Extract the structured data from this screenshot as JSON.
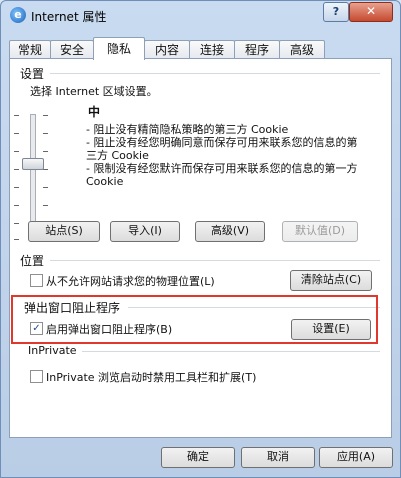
{
  "window": {
    "title": "Internet 属性",
    "help_label": "?",
    "close_label": "✕"
  },
  "tabs": [
    {
      "label": "常规"
    },
    {
      "label": "安全"
    },
    {
      "label": "隐私",
      "active": true
    },
    {
      "label": "内容"
    },
    {
      "label": "连接"
    },
    {
      "label": "程序"
    },
    {
      "label": "高级"
    }
  ],
  "settings": {
    "heading": "设置",
    "instruction": "选择 Internet 区域设置。",
    "level": "中",
    "descriptions": [
      "- 阻止没有精简隐私策略的第三方 Cookie",
      "- 阻止没有经您明确同意而保存可用来联系您的信息的第三方 Cookie",
      "- 限制没有经您默许而保存可用来联系您的信息的第一方 Cookie"
    ],
    "buttons": {
      "sites": "站点(S)",
      "import": "导入(I)",
      "advanced": "高级(V)",
      "default": "默认值(D)"
    }
  },
  "location": {
    "heading": "位置",
    "checkbox_label": "从不允许网站请求您的物理位置(L)",
    "checked": false,
    "clear_sites": "清除站点(C)"
  },
  "popup": {
    "heading": "弹出窗口阻止程序",
    "checkbox_label": "启用弹出窗口阻止程序(B)",
    "checked": true,
    "settings_button": "设置(E)"
  },
  "inprivate": {
    "heading": "InPrivate",
    "checkbox_label": "InPrivate 浏览启动时禁用工具栏和扩展(T)",
    "checked": false
  },
  "footer": {
    "ok": "确定",
    "cancel": "取消",
    "apply": "应用(A)"
  },
  "colors": {
    "highlight": "#e0382d",
    "window_frame": "#c9dbf0"
  }
}
